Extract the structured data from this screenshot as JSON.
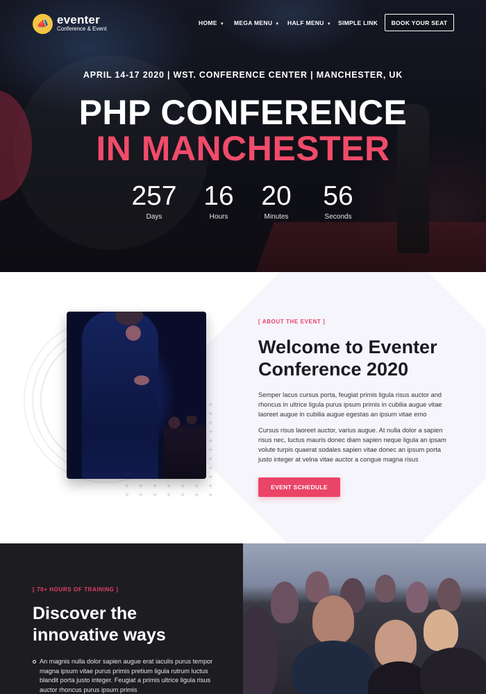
{
  "brand": {
    "name": "eventer",
    "tagline": "Conference & Event"
  },
  "nav": {
    "items": [
      {
        "label": "HOME",
        "caret": true
      },
      {
        "label": "MEGA MENU",
        "caret": true
      },
      {
        "label": "HALF MENU",
        "caret": true
      },
      {
        "label": "SIMPLE LINK",
        "caret": false
      }
    ],
    "cta": "BOOK YOUR SEAT"
  },
  "hero": {
    "meta": "APRIL 14-17 2020 | WST. CONFERENCE CENTER | MANCHESTER, UK",
    "title_line1": "PHP CONFERENCE",
    "title_line2": "IN MANCHESTER",
    "countdown": [
      {
        "value": "257",
        "label": "Days"
      },
      {
        "value": "16",
        "label": "Hours"
      },
      {
        "value": "20",
        "label": "Minutes"
      },
      {
        "value": "56",
        "label": "Seconds"
      }
    ]
  },
  "about": {
    "eyebrow": "[ ABOUT THE EVENT ]",
    "title": "Welcome to Eventer Conference 2020",
    "paragraph1": "Semper lacus cursus porta, feugiat primis ligula risus auctor and rhoncus in ultrice ligula purus ipsum primis in cubilia augue vitae laoreet augue in cubilia augue egestas an ipsum vitae emo",
    "paragraph2": "Cursus risus laoreet auctor, varius augue. At nulla dolor a sapien risus nec, luctus mauris donec diam sapien neque ligula an ipsam volute turpis quaerat sodales sapien vitae donec an ipsum porta justo integer at velna vitae auctor a congue magna risus",
    "button": "EVENT SCHEDULE"
  },
  "training": {
    "eyebrow": "[ 70+ HOURS OF TRAINING ]",
    "title": "Discover the innovative ways",
    "list": [
      "An magnis nulla dolor sapien augue erat iaculis purus tempor magna ipsum vitae purus primis pretium ligula rutrum luctus blandit porta justo integer. Feugiat a primis ultrice ligula risus auctor rhoncus purus ipsum primis"
    ]
  },
  "colors": {
    "accent": "#ea4467",
    "hero_pink": "#f04b6a",
    "dark": "#1d1c21",
    "logo_yellow": "#f5c542"
  }
}
